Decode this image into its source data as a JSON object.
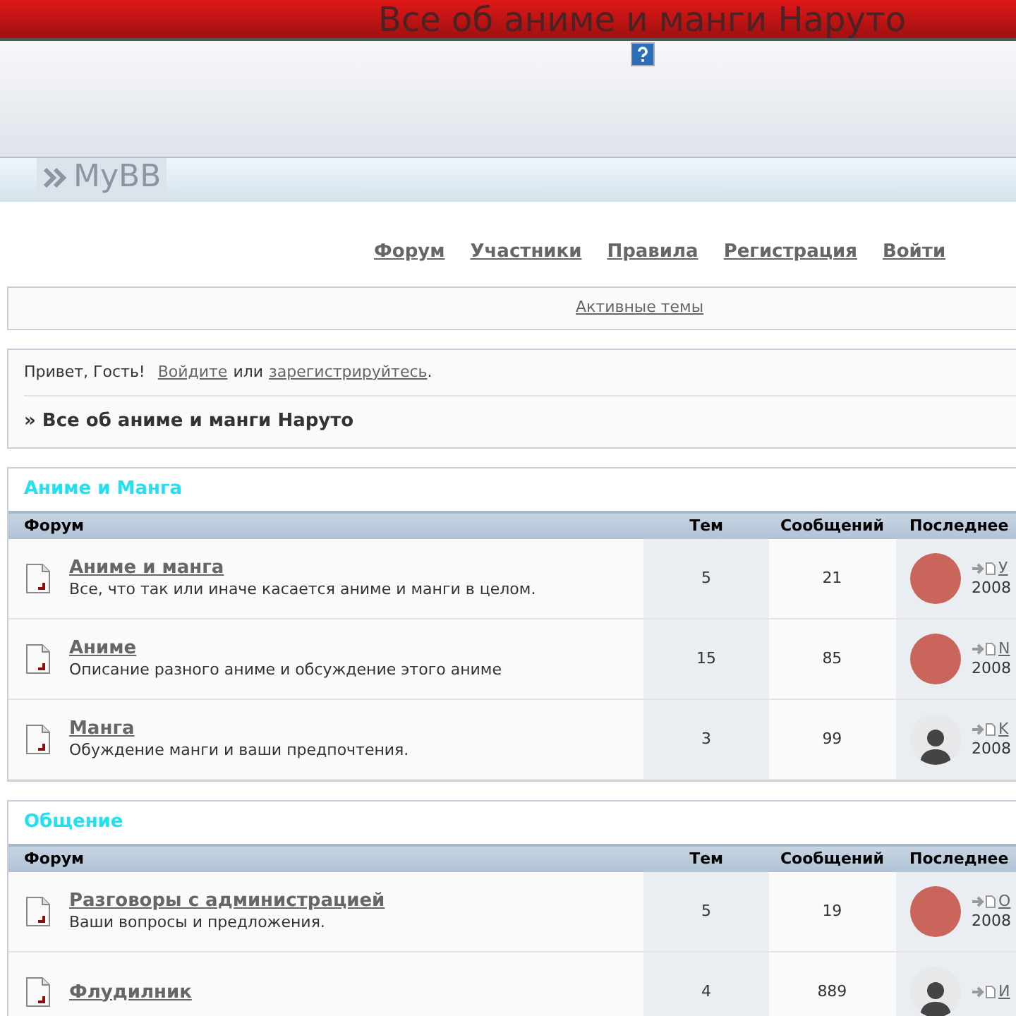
{
  "header": {
    "title": "Все об аниме и манги Наруто",
    "logo": "MyBB"
  },
  "nav": [
    {
      "label": "Форум"
    },
    {
      "label": "Участники"
    },
    {
      "label": "Правила"
    },
    {
      "label": "Регистрация"
    },
    {
      "label": "Войти"
    }
  ],
  "active_topics": "Активные темы",
  "welcome": {
    "greeting": "Привет, Гость!",
    "login_link": "Войдите",
    "or": "или",
    "register_link": "зарегистрируйтесь",
    "end": ".",
    "breadcrumb": "» Все об аниме и манги Наруто"
  },
  "categories": [
    {
      "title": "Аниме и Манга",
      "columns": [
        "Форум",
        "Тем",
        "Сообщений",
        "Последнее"
      ],
      "forums": [
        {
          "name": "Аниме и манга",
          "description": "Все, что так или иначе касается аниме и манги в целом.",
          "topics": "5",
          "posts": "21",
          "last_post": {
            "avatar": {
              "kind": "photo"
            },
            "author": "У",
            "date": "2008"
          }
        },
        {
          "name": "Аниме",
          "description": "Описание разного аниме и обсуждение этого аниме",
          "topics": "15",
          "posts": "85",
          "last_post": {
            "avatar": {
              "kind": "photo"
            },
            "author": "N",
            "date": "2008"
          }
        },
        {
          "name": "Манга",
          "description": "Обуждение манги и ваши предпочтения.",
          "topics": "3",
          "posts": "99",
          "last_post": {
            "avatar": {
              "kind": "default"
            },
            "author": "K",
            "date": "2008"
          }
        }
      ]
    },
    {
      "title": "Общение",
      "columns": [
        "Форум",
        "Тем",
        "Сообщений",
        "Последнее"
      ],
      "forums": [
        {
          "name": "Разговоры с администрацией",
          "description": "Ваши вопросы и предложения.",
          "topics": "5",
          "posts": "19",
          "last_post": {
            "avatar": {
              "kind": "photo"
            },
            "author": "О",
            "date": "2008"
          }
        },
        {
          "name": "Флудилник",
          "topics": "4",
          "posts": "889",
          "last_post": {
            "avatar": {
              "kind": "default"
            },
            "author": "И"
          }
        }
      ]
    }
  ]
}
